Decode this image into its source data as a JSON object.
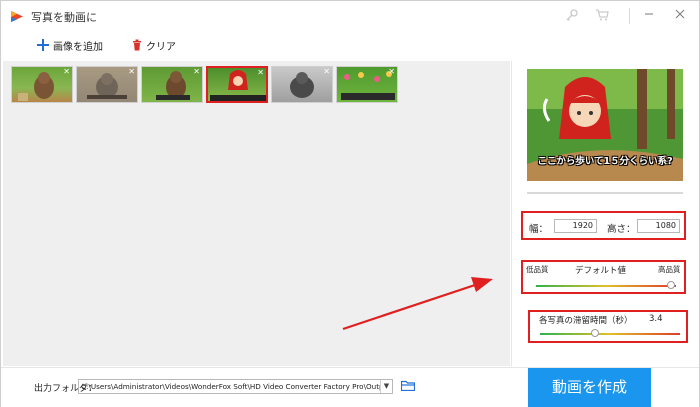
{
  "window": {
    "title": "写真を動画に"
  },
  "toolbar": {
    "add_images": "画像を追加",
    "clear": "クリア"
  },
  "thumbnails": [
    {
      "name": "thumb-1",
      "caption": "",
      "selected": false
    },
    {
      "name": "thumb-2",
      "caption": "",
      "selected": false
    },
    {
      "name": "thumb-3",
      "caption": "",
      "selected": false
    },
    {
      "name": "thumb-4",
      "caption": "ここから歩いて1５分",
      "selected": true
    },
    {
      "name": "thumb-5",
      "caption": "",
      "selected": false
    },
    {
      "name": "thumb-6",
      "caption": "ちょあれみてみ",
      "selected": false
    }
  ],
  "preview": {
    "caption": "ここから歩いて1５分くらい系?"
  },
  "size": {
    "width_label": "幅：",
    "width_value": "1920",
    "height_label": "高さ：",
    "height_value": "1080"
  },
  "quality": {
    "low_label": "低品質",
    "default_label": "デフォルト値",
    "high_label": "高品質",
    "level": 0.97
  },
  "duration": {
    "label": "各写真の滞留時間（秒）",
    "value": "3.4",
    "fraction": 0.4
  },
  "output": {
    "label": "出力フォルダ：",
    "path": "C:\\Users\\Administrator\\Videos\\WonderFox Soft\\HD Video Converter Factory Pro\\OutputVideo\\"
  },
  "create_button": "動画を作成",
  "colors": {
    "accent": "#1a96ee",
    "highlight": "#e02020"
  }
}
